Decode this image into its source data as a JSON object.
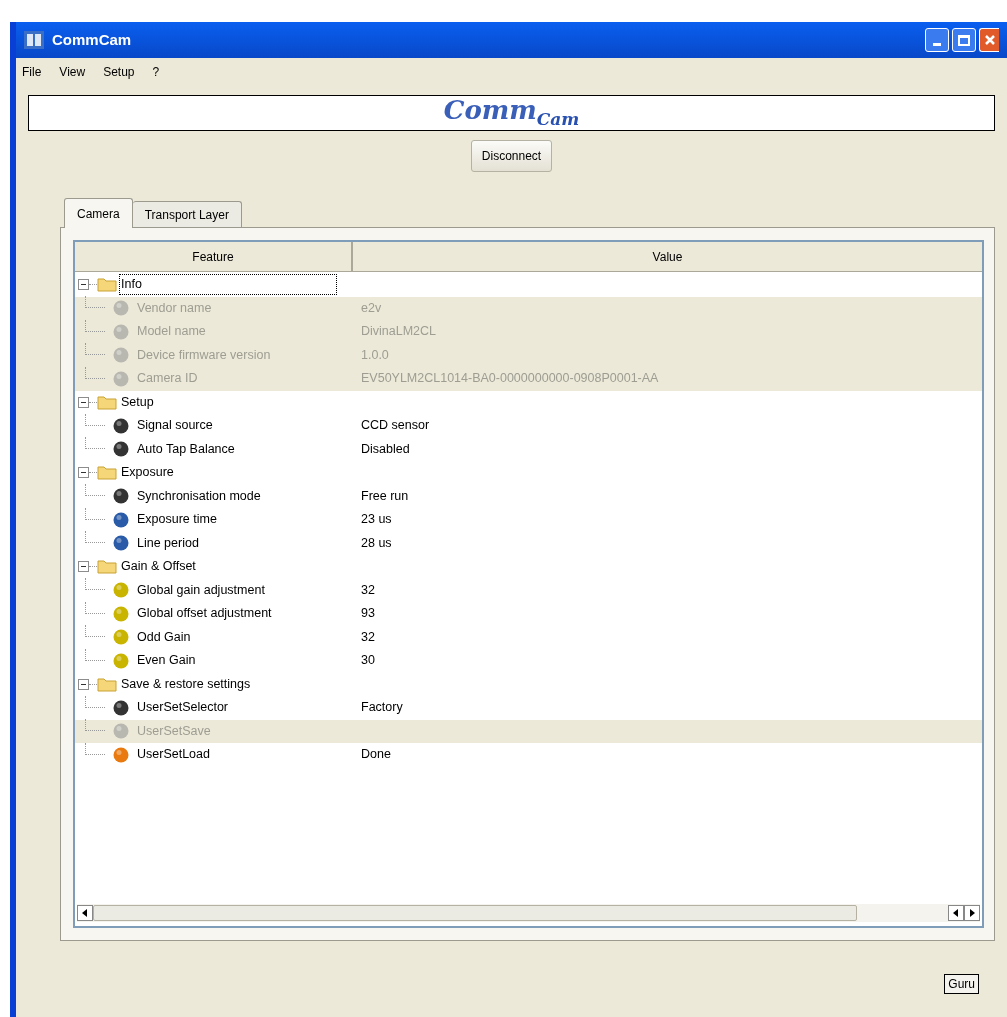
{
  "window": {
    "title": "CommCam"
  },
  "menu": [
    "File",
    "View",
    "Setup",
    "?"
  ],
  "logo": {
    "main": "Comm",
    "accent": "Cam"
  },
  "connect_button": "Disconnect",
  "tabs": [
    {
      "label": "Camera",
      "selected": true
    },
    {
      "label": "Transport Layer",
      "selected": false
    }
  ],
  "table": {
    "columns": [
      "Feature",
      "Value"
    ],
    "groups": [
      {
        "name": "Info",
        "expanded": true,
        "selected": true,
        "children": [
          {
            "name": "Vendor name",
            "value": "e2v",
            "kind": "string",
            "disabled": true
          },
          {
            "name": "Model name",
            "value": "DivinaLM2CL",
            "kind": "string",
            "disabled": true
          },
          {
            "name": "Device firmware version",
            "value": "1.0.0",
            "kind": "string",
            "disabled": true
          },
          {
            "name": "Camera ID",
            "value": "EV50YLM2CL1014-BA0-0000000000-0908P0001-AA",
            "kind": "string",
            "disabled": true
          }
        ]
      },
      {
        "name": "Setup",
        "expanded": true,
        "selected": false,
        "children": [
          {
            "name": "Signal source",
            "value": "CCD sensor",
            "kind": "enum",
            "disabled": false
          },
          {
            "name": "Auto Tap Balance",
            "value": "Disabled",
            "kind": "enum",
            "disabled": false
          }
        ]
      },
      {
        "name": "Exposure",
        "expanded": true,
        "selected": false,
        "children": [
          {
            "name": "Synchronisation mode",
            "value": "Free run",
            "kind": "enum",
            "disabled": false
          },
          {
            "name": "Exposure time",
            "value": "23 us",
            "kind": "float",
            "disabled": false
          },
          {
            "name": "Line period",
            "value": "28 us",
            "kind": "float",
            "disabled": false
          }
        ]
      },
      {
        "name": "Gain & Offset",
        "expanded": true,
        "selected": false,
        "children": [
          {
            "name": "Global gain adjustment",
            "value": "32",
            "kind": "integer",
            "disabled": false
          },
          {
            "name": "Global offset adjustment",
            "value": "93",
            "kind": "integer",
            "disabled": false
          },
          {
            "name": "Odd Gain",
            "value": "32",
            "kind": "integer",
            "disabled": false
          },
          {
            "name": "Even Gain",
            "value": "30",
            "kind": "integer",
            "disabled": false
          }
        ]
      },
      {
        "name": "Save & restore settings",
        "expanded": true,
        "selected": false,
        "children": [
          {
            "name": "UserSetSelector",
            "value": "Factory",
            "kind": "enum",
            "disabled": false
          },
          {
            "name": "UserSetSave",
            "kind": "command",
            "disabled": true
          },
          {
            "name": "UserSetLoad",
            "value": "Done",
            "kind": "command",
            "disabled": false
          }
        ]
      }
    ]
  },
  "guru_button": "Guru"
}
